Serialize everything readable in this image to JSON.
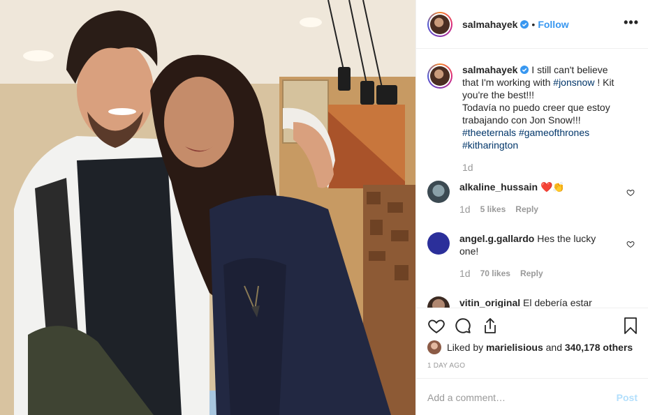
{
  "header": {
    "username": "salmahayek",
    "separator": "•",
    "follow_label": "Follow",
    "more_label": "•••"
  },
  "caption": {
    "username": "salmahayek",
    "text_before_tag": " I still can't believe that I'm working with ",
    "mention": "#jonsnow",
    "text_after_tag": " ! Kit you're the best!!!",
    "spanish": "Todavía no puedo creer que estoy trabajando con Jon Snow!!!",
    "hashtags": [
      "#theeternals",
      "#gameofthrones",
      "#kitharington"
    ],
    "time": "1d"
  },
  "comments": [
    {
      "username": "alkaline_hussain",
      "text": " ❤️👏",
      "time": "1d",
      "likes": "5 likes",
      "reply": "Reply"
    },
    {
      "username": "angel.g.gallardo",
      "text": " Hes the lucky one!",
      "time": "1d",
      "likes": "70 likes",
      "reply": "Reply"
    },
    {
      "username": "vitin_original",
      "text": " El debería estar"
    }
  ],
  "engagement": {
    "liked_by_prefix": "Liked by ",
    "liked_by_user": "marielisious",
    "and_label": " and ",
    "others": "340,178 others",
    "time_ago": "1 DAY AGO"
  },
  "comment_box": {
    "placeholder": "Add a comment…",
    "post_label": "Post"
  },
  "colors": {
    "accent": "#3897f0",
    "hashtag": "#003569",
    "muted": "#999999",
    "post_disabled": "#b2dffc"
  }
}
